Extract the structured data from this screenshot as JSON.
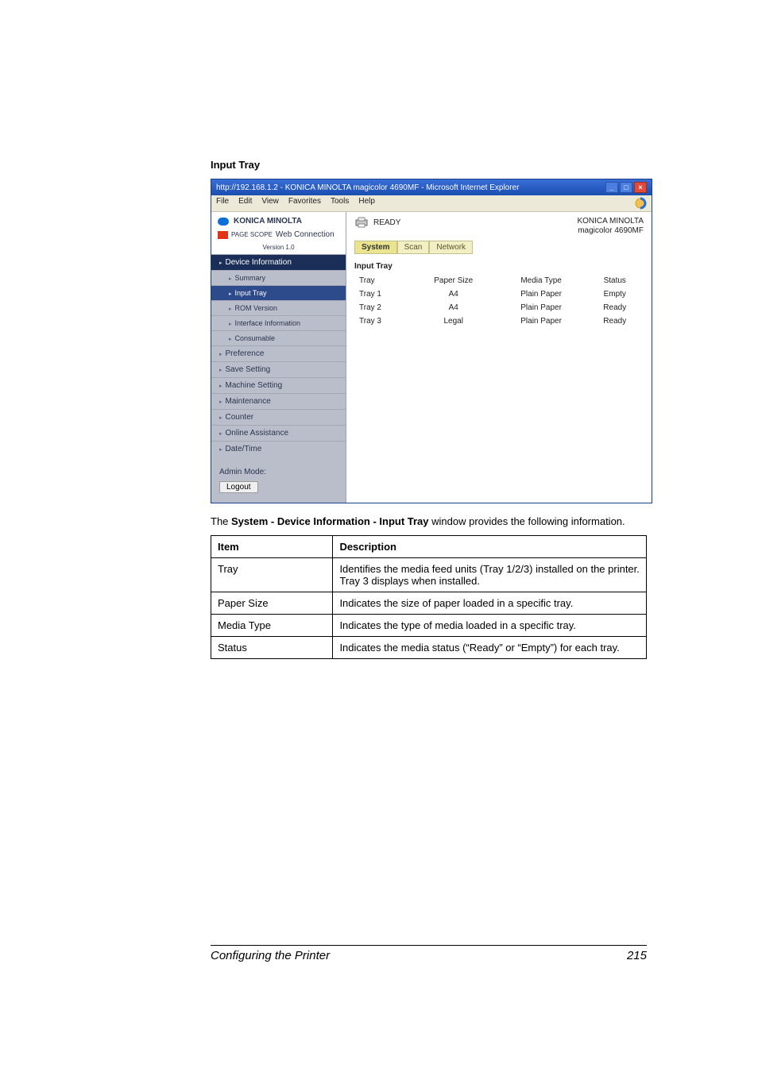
{
  "section_heading": "Input Tray",
  "window": {
    "title": "http://192.168.1.2 - KONICA MINOLTA magicolor 4690MF - Microsoft Internet Explorer",
    "menus": [
      "File",
      "Edit",
      "View",
      "Favorites",
      "Tools",
      "Help"
    ]
  },
  "brand": {
    "line1": "KONICA MINOLTA",
    "ps_label_small": "PAGE SCOPE",
    "line2": "Web Connection",
    "version": "Version 1.0"
  },
  "sidebar": {
    "items": [
      {
        "label": "Device Information",
        "level": 1,
        "active": true
      },
      {
        "label": "Summary",
        "level": 2
      },
      {
        "label": "Input Tray",
        "level": 2,
        "selected": true
      },
      {
        "label": "ROM Version",
        "level": 2
      },
      {
        "label": "Interface Information",
        "level": 2
      },
      {
        "label": "Consumable",
        "level": 2
      },
      {
        "label": "Preference",
        "level": 1
      },
      {
        "label": "Save Setting",
        "level": 1
      },
      {
        "label": "Machine Setting",
        "level": 1
      },
      {
        "label": "Maintenance",
        "level": 1
      },
      {
        "label": "Counter",
        "level": 1
      },
      {
        "label": "Online Assistance",
        "level": 1
      },
      {
        "label": "Date/Time",
        "level": 1
      }
    ],
    "admin_mode": "Admin Mode:",
    "logout": "Logout"
  },
  "main": {
    "ready": "READY",
    "corp1": "KONICA MINOLTA",
    "corp2": "magicolor 4690MF",
    "tabs": [
      "System",
      "Scan",
      "Network"
    ],
    "active_tab": 0,
    "panel_title": "Input Tray",
    "columns": [
      "Tray",
      "Paper Size",
      "Media Type",
      "Status"
    ],
    "rows": [
      {
        "tray": "Tray 1",
        "size": "A4",
        "media": "Plain Paper",
        "status": "Empty"
      },
      {
        "tray": "Tray 2",
        "size": "A4",
        "media": "Plain Paper",
        "status": "Ready"
      },
      {
        "tray": "Tray 3",
        "size": "Legal",
        "media": "Plain Paper",
        "status": "Ready"
      }
    ]
  },
  "body_text_prefix": "The ",
  "body_text_bold": "System - Device Information - Input Tray",
  "body_text_suffix": " window provides the following information.",
  "table": {
    "head_item": "Item",
    "head_desc": "Description",
    "rows": [
      {
        "item": "Tray",
        "desc": "Identifies the media feed units (Tray 1/2/3) installed on the printer. Tray 3 displays when installed."
      },
      {
        "item": "Paper Size",
        "desc": "Indicates the size of paper loaded in a specific tray."
      },
      {
        "item": "Media Type",
        "desc": "Indicates the type of media loaded in a specific tray."
      },
      {
        "item": "Status",
        "desc": "Indicates the media status (“Ready” or “Empty”) for each tray."
      }
    ]
  },
  "footer": {
    "left": "Configuring the Printer",
    "right": "215"
  }
}
